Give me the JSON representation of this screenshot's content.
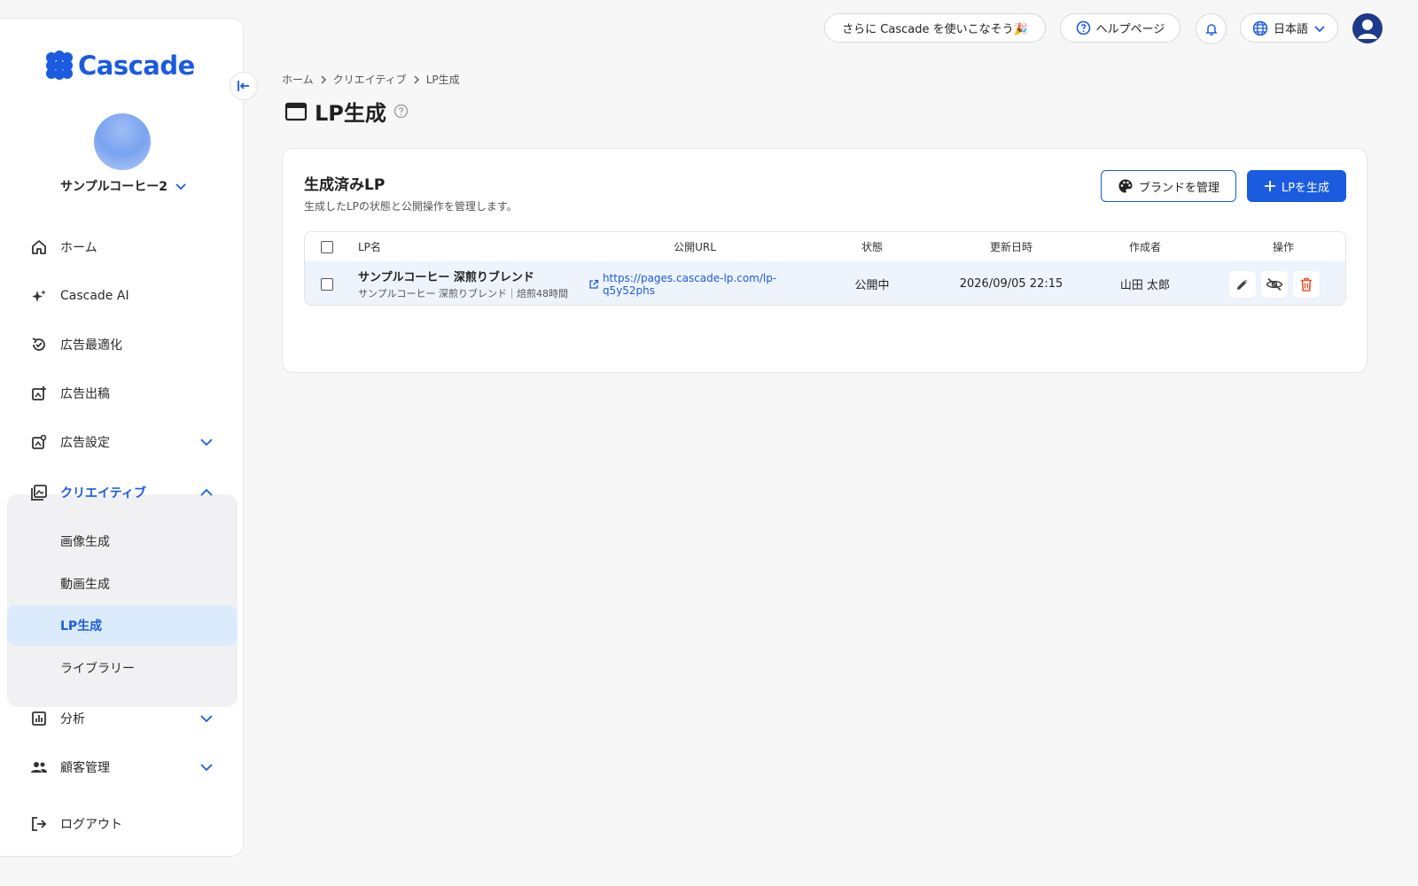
{
  "brand": {
    "name": "Cascade",
    "color": "#1a5be0"
  },
  "account": {
    "name": "サンプルコーヒー2"
  },
  "sidebar": {
    "items": [
      {
        "label": "ホーム",
        "icon": "home-icon"
      },
      {
        "label": "Cascade AI",
        "icon": "sparkle-icon"
      },
      {
        "label": "広告最適化",
        "icon": "optimize-icon"
      },
      {
        "label": "広告出稿",
        "icon": "publish-icon"
      },
      {
        "label": "広告設定",
        "icon": "ad-settings-icon"
      },
      {
        "label": "クリエイティブ",
        "icon": "gallery-icon"
      },
      {
        "label": "分析",
        "icon": "chart-icon"
      },
      {
        "label": "顧客管理",
        "icon": "people-icon"
      },
      {
        "label": "ログアウト",
        "icon": "logout-icon"
      }
    ],
    "creative_sub": [
      "画像生成",
      "動画生成",
      "LP生成",
      "ライブラリー"
    ]
  },
  "topbar": {
    "promo": "さらに Cascade を使いこなそう🎉",
    "help": "ヘルプページ",
    "language": "日本語"
  },
  "breadcrumb": [
    "ホーム",
    "クリエイティブ",
    "LP生成"
  ],
  "page": {
    "title": "LP生成"
  },
  "card": {
    "title": "生成済みLP",
    "subtitle": "生成したLPの状態と公開操作を管理します。",
    "brand_button": "ブランドを管理",
    "create_button": "LPを生成"
  },
  "table": {
    "headers": [
      "LP名",
      "公開URL",
      "状態",
      "更新日時",
      "作成者",
      "操作"
    ],
    "rows": [
      {
        "name": "サンプルコーヒー 深煎りブレンド",
        "desc": "サンプルコーヒー 深煎りブレンド｜焙煎48時間",
        "url": "https://pages.cascade-lp.com/lp-q5y52phs",
        "status": "公開中",
        "updated": "2026/09/05 22:15",
        "author": "山田 太郎"
      }
    ]
  }
}
